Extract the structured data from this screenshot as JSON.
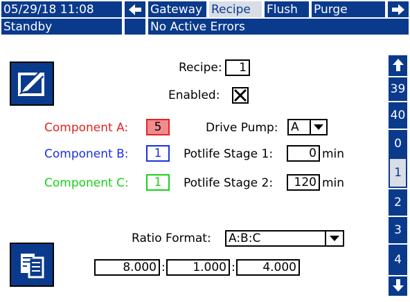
{
  "header": {
    "datetime": "05/29/18 11:08",
    "tabs": [
      "Gateway",
      "Recipe",
      "Flush",
      "Purge"
    ],
    "status": "Standby",
    "errors": "No Active Errors"
  },
  "form": {
    "recipe_label": "Recipe:",
    "recipe_value": "1",
    "enabled_label": "Enabled:",
    "enabled_value": "X",
    "component_a_label": "Component A:",
    "component_a_value": "5",
    "component_b_label": "Component B:",
    "component_b_value": "1",
    "component_c_label": "Component C:",
    "component_c_value": "1",
    "drive_pump_label": "Drive Pump:",
    "drive_pump_value": "A",
    "potlife1_label": "Potlife Stage 1:",
    "potlife1_value": "0",
    "potlife1_unit": "min",
    "potlife2_label": "Potlife Stage 2:",
    "potlife2_value": "120",
    "potlife2_unit": "min",
    "ratio_format_label": "Ratio Format:",
    "ratio_format_value": "A:B:C",
    "ratio_a": "8.000",
    "ratio_b": "1.000",
    "ratio_c": "4.000",
    "ratio_sep": ":"
  },
  "sidebar": {
    "items": [
      "39",
      "40",
      "0",
      "1",
      "2",
      "3",
      "4"
    ],
    "selected": "1"
  },
  "colors": {
    "header_blue": "#0a3a8c",
    "component_a": "#e82020",
    "component_b": "#1a30e0",
    "component_c": "#18d018",
    "component_a_fill": "#f08c8c"
  },
  "icons": [
    "arrow-left-icon",
    "arrow-right-icon",
    "edit-icon",
    "copy-icon",
    "arrow-up-icon",
    "arrow-down-icon"
  ]
}
